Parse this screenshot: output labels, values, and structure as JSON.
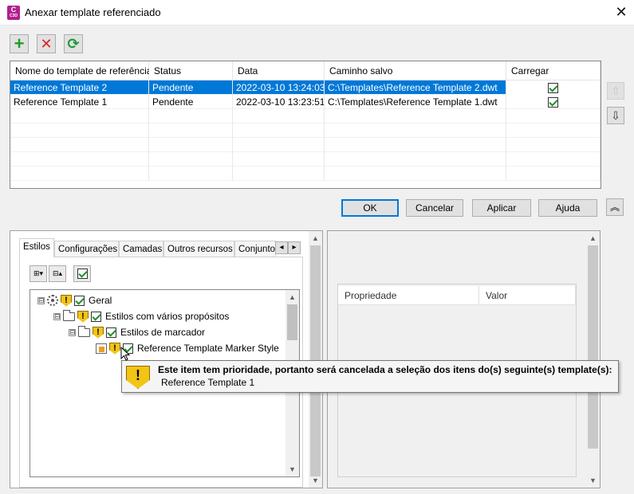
{
  "window": {
    "title": "Anexar template referenciado",
    "app_icon_text": "C",
    "app_icon_subtext": "C3D",
    "close_glyph": "✕"
  },
  "toolbar": {
    "add_glyph": "+",
    "remove_glyph": "✕",
    "refresh_glyph": "⟳"
  },
  "table": {
    "columns": [
      "Nome do template de referência",
      "Status",
      "Data",
      "Caminho salvo",
      "Carregar"
    ],
    "rows": [
      {
        "name": "Reference Template 2",
        "status": "Pendente",
        "date": "2022-03-10 13:24:03",
        "path": "C:\\Templates\\Reference Template 2.dwt",
        "load": true,
        "selected": true
      },
      {
        "name": "Reference Template 1",
        "status": "Pendente",
        "date": "2022-03-10 13:23:51",
        "path": "C:\\Templates\\Reference Template 1.dwt",
        "load": true,
        "selected": false
      }
    ]
  },
  "side_buttons": {
    "up_glyph": "⇧",
    "down_glyph": "⇩"
  },
  "dialog_buttons": {
    "ok": "OK",
    "cancel": "Cancelar",
    "apply": "Aplicar",
    "help": "Ajuda",
    "collapse_glyph": "︽"
  },
  "tabs": [
    "Estilos",
    "Configurações",
    "Camadas",
    "Outros recursos",
    "Conjunto"
  ],
  "tab_scroll": {
    "left": "◂",
    "right": "▸"
  },
  "tree_toolbar": {
    "expand_glyph": "⊞▾",
    "collapse_glyph": "⊟▴"
  },
  "tree": [
    {
      "label": "Geral",
      "expander": "⊟",
      "icon": "gear-icon",
      "warning": true,
      "checked": true
    },
    {
      "label": "Estilos com vários propósitos",
      "expander": "⊟",
      "icon": "folder-icon",
      "warning": true,
      "checked": true
    },
    {
      "label": "Estilos de marcador",
      "expander": "⊟",
      "icon": "folder-icon",
      "warning": true,
      "checked": true
    },
    {
      "label": "Reference Template Marker Style",
      "expander": "",
      "icon": "marker-style-icon",
      "warning": true,
      "checked": true
    }
  ],
  "property_grid": {
    "columns": [
      "Propriedade",
      "Valor"
    ]
  },
  "tooltip": {
    "title": "Este item tem prioridade, portanto será cancelada a seleção dos itens do(s) seguinte(s) template(s):",
    "item": "Reference Template 1",
    "warn_glyph": "!"
  },
  "colors": {
    "selection": "#0078d7",
    "warning": "#f2c414",
    "app_icon": "#b3208e"
  }
}
